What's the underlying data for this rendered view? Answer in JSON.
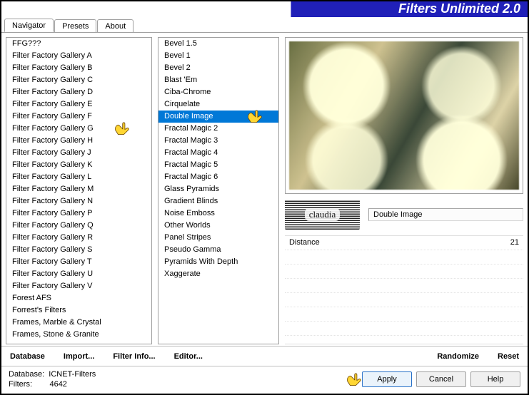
{
  "title": "Filters Unlimited 2.0",
  "tabs": {
    "navigator": "Navigator",
    "presets": "Presets",
    "about": "About"
  },
  "category_items": [
    "FFG???",
    "Filter Factory Gallery A",
    "Filter Factory Gallery B",
    "Filter Factory Gallery C",
    "Filter Factory Gallery D",
    "Filter Factory Gallery E",
    "Filter Factory Gallery F",
    "Filter Factory Gallery G",
    "Filter Factory Gallery H",
    "Filter Factory Gallery J",
    "Filter Factory Gallery K",
    "Filter Factory Gallery L",
    "Filter Factory Gallery M",
    "Filter Factory Gallery N",
    "Filter Factory Gallery P",
    "Filter Factory Gallery Q",
    "Filter Factory Gallery R",
    "Filter Factory Gallery S",
    "Filter Factory Gallery T",
    "Filter Factory Gallery U",
    "Filter Factory Gallery V",
    "Forest AFS",
    "Forrest's Filters",
    "Frames, Marble & Crystal",
    "Frames, Stone & Granite"
  ],
  "selected_category_index": 7,
  "filter_items": [
    "Bevel 1.5",
    "Bevel 1",
    "Bevel 2",
    "Blast 'Em",
    "Ciba-Chrome",
    "Cirquelate",
    "Double Image",
    "Fractal Magic 2",
    "Fractal Magic 3",
    "Fractal Magic 4",
    "Fractal Magic 5",
    "Fractal Magic 6",
    "Glass Pyramids",
    "Gradient Blinds",
    "Noise Emboss",
    "Other Worlds",
    "Panel Stripes",
    "Pseudo Gamma",
    "Pyramids With Depth",
    "Xaggerate"
  ],
  "selected_filter_index": 6,
  "stamp_text": "claudia",
  "current_filter_label": "Double Image",
  "sliders": [
    {
      "label": "Distance",
      "value": "21"
    }
  ],
  "link_buttons": {
    "database": "Database",
    "import": "Import...",
    "filter_info": "Filter Info...",
    "editor": "Editor...",
    "randomize": "Randomize",
    "reset": "Reset"
  },
  "status": {
    "database_label": "Database:",
    "database_value": "ICNET-Filters",
    "filters_label": "Filters:",
    "filters_value": "4642"
  },
  "push_buttons": {
    "apply": "Apply",
    "cancel": "Cancel",
    "help": "Help"
  }
}
